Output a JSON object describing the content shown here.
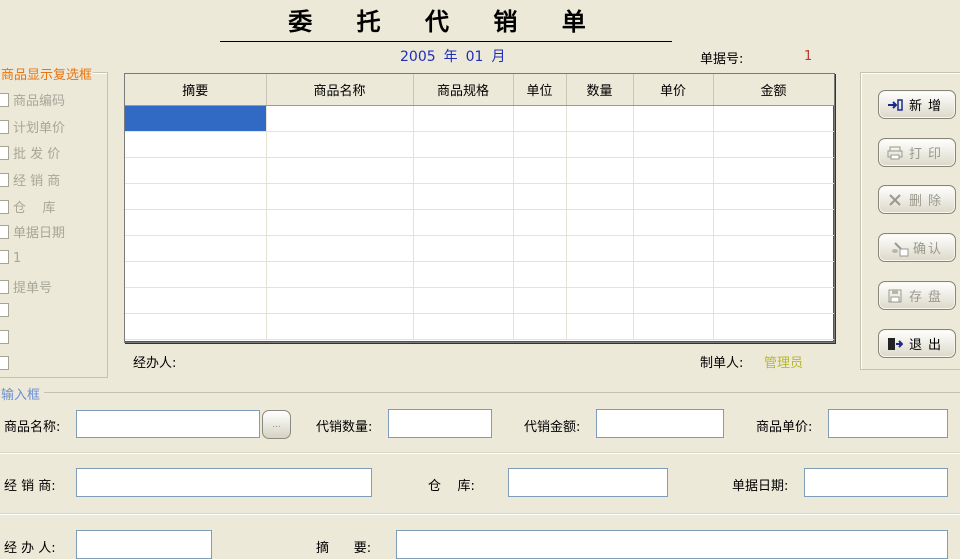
{
  "title": "委 托 代 销 单",
  "date": {
    "year": "2005",
    "year_unit": "年",
    "month": "01",
    "month_unit": "月"
  },
  "doc_no": {
    "label": "单据号:",
    "value": "1"
  },
  "left_group": {
    "legend": "商品显示复选框",
    "items": [
      "商品编码",
      "计划单价",
      "批 发 价",
      "经 销 商",
      "仓    库",
      "单据日期",
      "1",
      "提单号",
      "",
      "",
      ""
    ]
  },
  "grid": {
    "columns": [
      "摘要",
      "商品名称",
      "商品规格",
      "单位",
      "数量",
      "单价",
      "金额"
    ],
    "rows": 9
  },
  "handler_label": "经办人:",
  "maker": {
    "label": "制单人:",
    "value": "管理员"
  },
  "buttons": {
    "add": "新增",
    "print": "打印",
    "delete": "删除",
    "confirm": "确认",
    "save": "存盘",
    "exit": "退出"
  },
  "input_frame": {
    "legend": "输入框",
    "product_name_label": "商品名称:",
    "browse_label": "...",
    "consign_qty_label": "代销数量:",
    "consign_amount_label": "代销金额:",
    "unit_price_label": "商品单价:",
    "dealer_label": "经 销 商:",
    "warehouse_label": "仓    库:",
    "doc_date_label": "单据日期:",
    "handler_label": "经 办 人:",
    "summary_label": "摘      要:"
  },
  "colors": {
    "background": "#ece9d8",
    "selection": "#316ac5",
    "date_text": "#1e2fb8",
    "doc_no_value": "#c0392b",
    "group_legend": "#e8730f",
    "input_legend": "#6b8ed6",
    "maker_value": "#b8b82e"
  }
}
